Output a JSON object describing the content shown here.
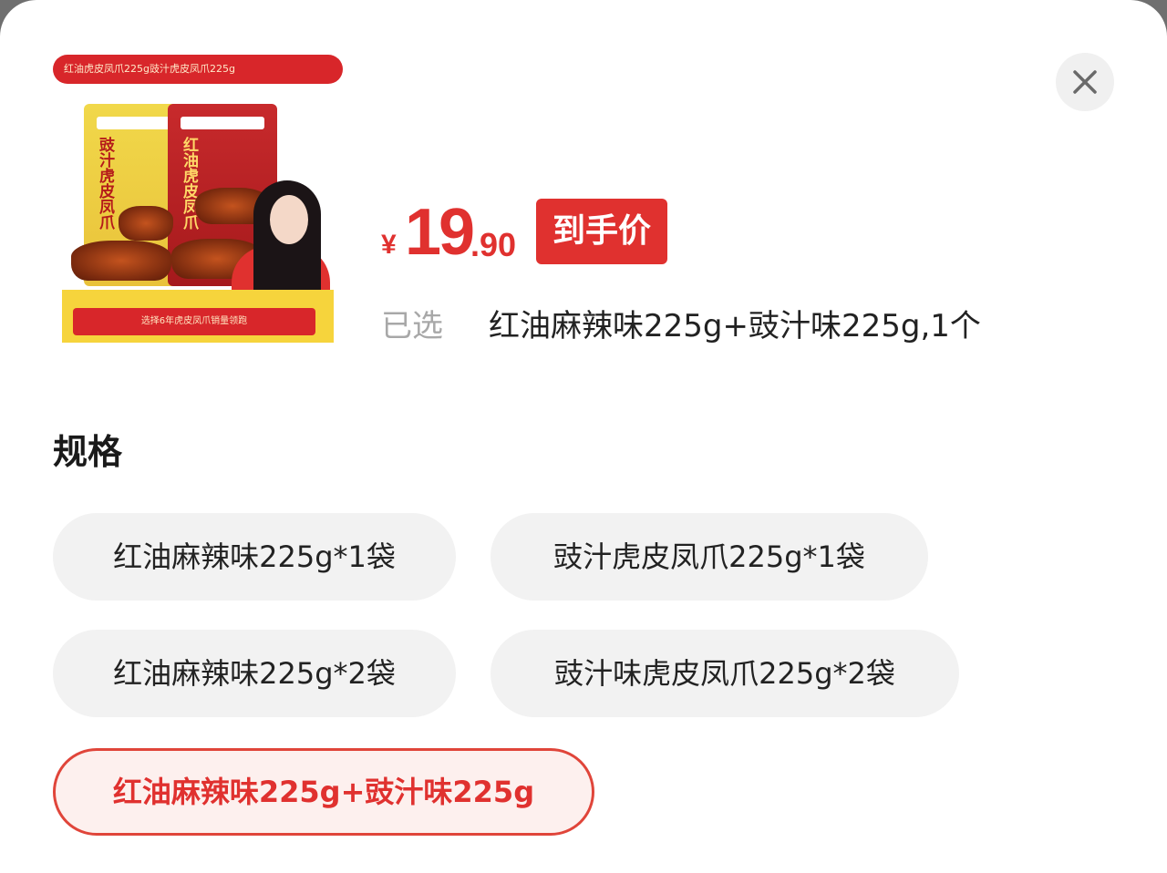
{
  "product": {
    "image_banner_text": "红油虎皮凤爪225g豉汁虎皮凤爪225g",
    "image_bag_left_text": "豉汁虎皮凤爪",
    "image_bag_right_text": "红油虎皮凤爪",
    "image_bottom_text": "选择6年虎皮凤爪销量领跑"
  },
  "price": {
    "currency": "¥",
    "integer": "19",
    "decimal": ".90",
    "tag": "到手价"
  },
  "selection": {
    "label": "已选",
    "value": "红油麻辣味225g+豉汁味225g,1个"
  },
  "spec": {
    "title": "规格",
    "options": [
      {
        "label": "红油麻辣味225g*1袋",
        "selected": false
      },
      {
        "label": "豉汁虎皮凤爪225g*1袋",
        "selected": false
      },
      {
        "label": "红油麻辣味225g*2袋",
        "selected": false
      },
      {
        "label": "豉汁味虎皮凤爪225g*2袋",
        "selected": false
      },
      {
        "label": "红油麻辣味225g+豉汁味225g",
        "selected": true
      }
    ]
  },
  "colors": {
    "accent": "#e0312f",
    "option_bg": "#f2f2f2",
    "selected_bg": "#fdf0ee"
  },
  "icons": {
    "close": "close-icon"
  }
}
